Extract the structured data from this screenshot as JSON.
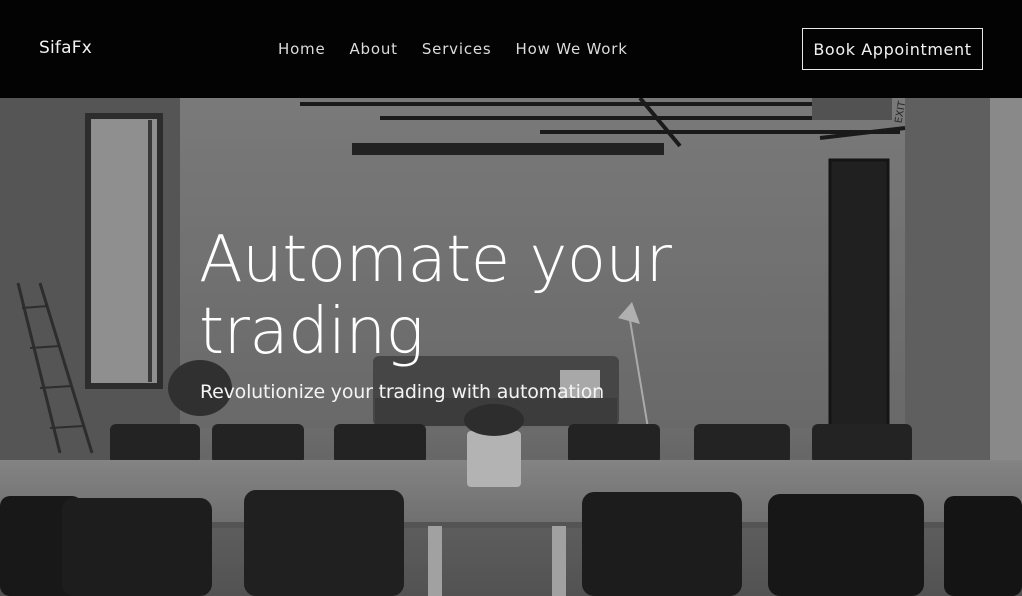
{
  "header": {
    "brand": "SifaFx",
    "nav": [
      {
        "label": "Home"
      },
      {
        "label": "About"
      },
      {
        "label": "Services"
      },
      {
        "label": "How We Work"
      }
    ],
    "cta_label": "Book Appointment"
  },
  "hero": {
    "title": "Automate your trading",
    "subtitle": "Revolutionize your trading with automation",
    "exit_sign": "EXIT"
  },
  "colors": {
    "navbar_bg": "#030303",
    "text": "#ffffff",
    "photo_wall": "#8e8e8e"
  }
}
